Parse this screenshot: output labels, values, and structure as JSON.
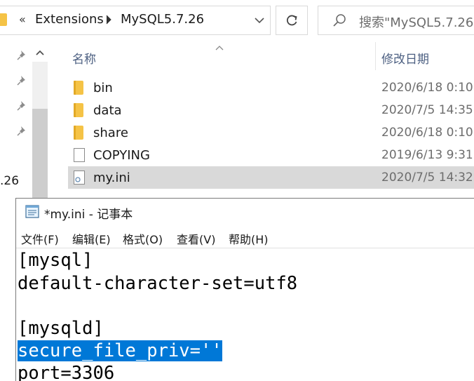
{
  "explorer": {
    "breadcrumb": {
      "overflow": "«",
      "items": [
        "Extensions",
        "MySQL5.7.26"
      ],
      "separator": ">"
    },
    "search_placeholder": "搜索\"MySQL5.7.26\"",
    "nav_partial_label": ".26",
    "columns": {
      "name": "名称",
      "date": "修改日期"
    },
    "files": [
      {
        "name": "bin",
        "date": "2020/6/18 0:10",
        "type": "folder"
      },
      {
        "name": "data",
        "date": "2020/7/5 14:35",
        "type": "folder"
      },
      {
        "name": "share",
        "date": "2020/6/18 0:10",
        "type": "folder"
      },
      {
        "name": "COPYING",
        "date": "2019/6/13 9:31",
        "type": "file"
      },
      {
        "name": "my.ini",
        "date": "2020/7/5 14:32",
        "type": "ini",
        "selected": true
      }
    ]
  },
  "notepad": {
    "title": "*my.ini - 记事本",
    "menu": [
      "文件(F)",
      "编辑(E)",
      "格式(O)",
      "查看(V)",
      "帮助(H)"
    ],
    "lines": [
      "[mysql]",
      "default-character-set=utf8",
      "",
      "[mysqld]",
      "secure_file_priv=''",
      "port=3306"
    ],
    "selected_line_index": 4
  },
  "colors": {
    "selection": "#0078d7",
    "row_selected": "#d9d9d9",
    "folder": "#f5c346",
    "header_text": "#4d6082"
  }
}
